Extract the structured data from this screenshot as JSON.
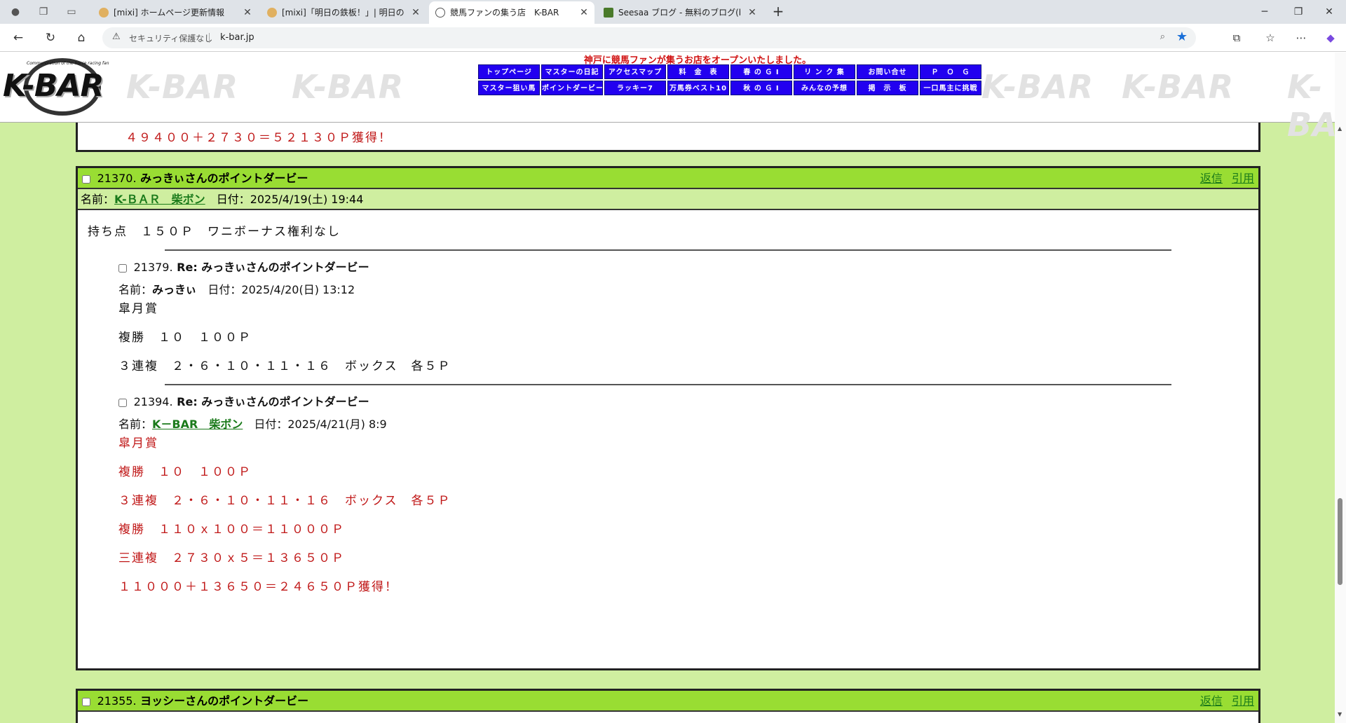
{
  "browser": {
    "tabs": [
      {
        "title": "[mixi] ホームページ更新情報",
        "active": false
      },
      {
        "title": "[mixi]「明日の鉄板！」| 明日の鉄板",
        "active": false
      },
      {
        "title": "競馬ファンの集う店　K-BAR",
        "active": true
      },
      {
        "title": "Seesaa ブログ - 無料のブログ(blog)サ",
        "active": false
      }
    ],
    "security_label": "セキュリティ保護なし",
    "url": "k-bar.jp"
  },
  "site": {
    "logo_text": "K-BAR",
    "logo_sub": "Communication of the horse racing fan",
    "watermark": "K-BAR",
    "tagline": "神戸に競馬ファンが集うお店をオープンいたしました。",
    "nav_row1": [
      "トップページ",
      "マスターの日記",
      "アクセスマップ",
      "料　金　表",
      "春 の Ｇ Ⅰ",
      "リ ン ク 集",
      "お問い合せ",
      "Ｐ　Ｏ　Ｇ"
    ],
    "nav_row2": [
      "マスター狙い馬",
      "ポイントダービー",
      "ラッキー7",
      "万馬券ベスト10",
      "秋 の Ｇ Ⅰ",
      "みんなの予想",
      "掲　示　板",
      "一口馬主に挑戦"
    ]
  },
  "prev_post_tail": "４９４００＋２７３０＝５２１３０Ｐ獲得！",
  "post": {
    "number": "21370.",
    "title": "みっきぃさんのポイントダービー",
    "reply_label": "返信",
    "quote_label": "引用",
    "name_label": "名前：",
    "name": "K-ＢＡＲ　柴ボン",
    "date": "日付：2025/4/19(土) 19:44",
    "body": "持ち点　１５０Ｐ　ワニボーナス権利なし",
    "replies": [
      {
        "number": "21379.",
        "title": "Re: みっきぃさんのポイントダービー",
        "name_label": "名前：",
        "name": "みっきぃ",
        "date": "日付：2025/4/20(日) 13:12",
        "lines": [
          "皐月賞",
          "複勝　１０　１００Ｐ",
          "３連複　２・６・１０・１１・１６　ボックス　各５Ｐ"
        ]
      },
      {
        "number": "21394.",
        "title": "Re: みっきぃさんのポイントダービー",
        "name_label": "名前：",
        "name": "K－BAR　柴ボン",
        "date": "日付：2025/4/21(月) 8:9",
        "lines": [
          "皐月賞",
          "複勝　１０　１００Ｐ",
          "３連複　２・６・１０・１１・１６　ボックス　各５Ｐ",
          "複勝　１１０ｘ１００＝１１０００Ｐ",
          "三連複　２７３０ｘ５＝１３６５０Ｐ",
          "１１０００＋１３６５０＝２４６５０Ｐ獲得！"
        ]
      }
    ]
  },
  "next_post": {
    "number": "21355.",
    "title": "ヨッシーさんのポイントダービー",
    "reply_label": "返信",
    "quote_label": "引用"
  },
  "colors": {
    "post_header": "#99dd33",
    "meta_bg": "#cfeea0",
    "nav_button": "#2200f0",
    "red_text": "#c01818",
    "link_green": "#1a7a1a"
  }
}
